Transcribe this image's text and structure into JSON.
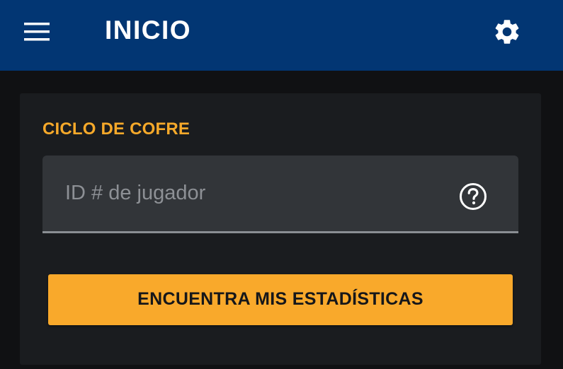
{
  "header": {
    "title": "INICIO",
    "menu_icon": "hamburger-menu-icon",
    "settings_icon": "gear-icon",
    "background_color": "#023673"
  },
  "main": {
    "section_title": "CICLO DE COFRE",
    "player_id_input": {
      "placeholder": "ID # de jugador",
      "value": "",
      "help_icon": "help-circle-icon"
    },
    "submit_button": {
      "label": "ENCUENTRA MIS ESTADÍSTICAS"
    }
  },
  "colors": {
    "accent": "#f9a92b",
    "page_background": "#101113",
    "card_background": "#1a1c1f",
    "input_background": "#323539"
  }
}
